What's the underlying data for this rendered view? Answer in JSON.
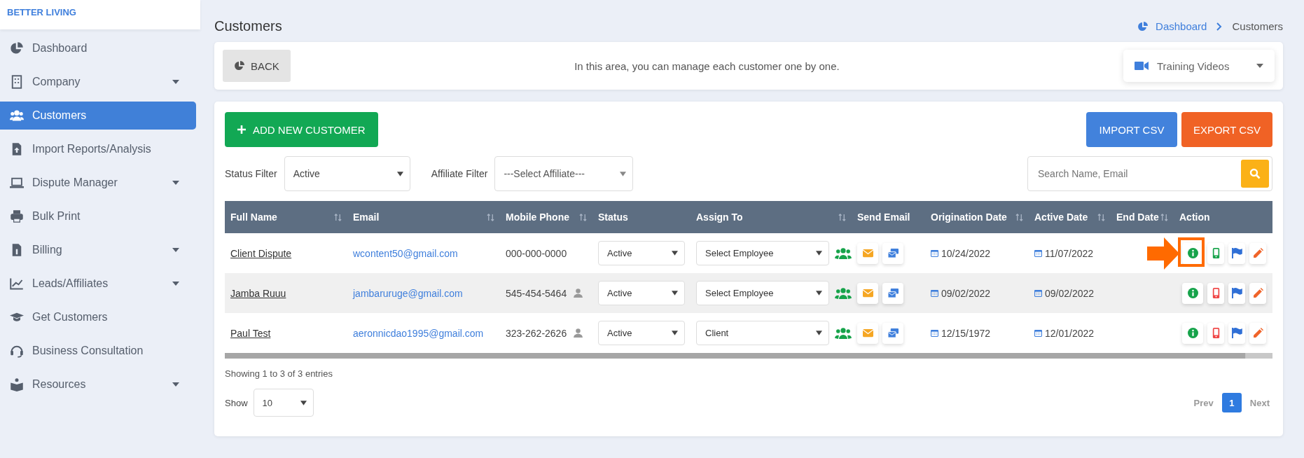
{
  "brand": "BETTER LIVING",
  "sidebar": {
    "items": [
      {
        "label": "Dashboard",
        "kind": "pie",
        "has_dropdown": false,
        "selected": false
      },
      {
        "label": "Company",
        "kind": "building",
        "has_dropdown": true,
        "selected": false
      },
      {
        "label": "Customers",
        "kind": "users",
        "has_dropdown": false,
        "selected": true
      },
      {
        "label": "Import Reports/Analysis",
        "kind": "upload",
        "has_dropdown": false,
        "selected": false
      },
      {
        "label": "Dispute Manager",
        "kind": "laptop",
        "has_dropdown": true,
        "selected": false
      },
      {
        "label": "Bulk Print",
        "kind": "printer",
        "has_dropdown": false,
        "selected": false
      },
      {
        "label": "Billing",
        "kind": "invoice",
        "has_dropdown": true,
        "selected": false
      },
      {
        "label": "Leads/Affiliates",
        "kind": "chart",
        "has_dropdown": true,
        "selected": false
      },
      {
        "label": "Get Customers",
        "kind": "cap",
        "has_dropdown": false,
        "selected": false
      },
      {
        "label": "Business Consultation",
        "kind": "headset",
        "has_dropdown": false,
        "selected": false
      },
      {
        "label": "Resources",
        "kind": "book",
        "has_dropdown": true,
        "selected": false
      }
    ]
  },
  "page_title": "Customers",
  "breadcrumb": [
    "Dashboard",
    "Customers"
  ],
  "intro": {
    "back_button": "BACK",
    "message": "In this area, you can manage each customer one by one.",
    "training_videos": "Training Videos"
  },
  "toolbar": {
    "add_button": "ADD NEW CUSTOMER",
    "import_button": "IMPORT CSV",
    "export_button": "EXPORT CSV"
  },
  "filters": {
    "status_label": "Status Filter",
    "status_value": "Active",
    "affiliate_label": "Affiliate Filter",
    "affiliate_value": "---Select Affiliate---",
    "search_placeholder": "Search Name, Email"
  },
  "table": {
    "columns": [
      {
        "label": "Full Name",
        "sortable": true
      },
      {
        "label": "Email",
        "sortable": true
      },
      {
        "label": "Mobile Phone",
        "sortable": true
      },
      {
        "label": "Status",
        "sortable": false
      },
      {
        "label": "Assign To",
        "sortable": true
      },
      {
        "label": "Send Email",
        "sortable": false
      },
      {
        "label": "Origination Date",
        "sortable": true
      },
      {
        "label": "Active Date",
        "sortable": true
      },
      {
        "label": "End Date",
        "sortable": true
      },
      {
        "label": "Action",
        "sortable": false
      }
    ],
    "rows": [
      {
        "name": "Client Dispute",
        "email": "wcontent50@gmail.com",
        "phone": "000-000-0000",
        "contact_icon": false,
        "status": "Active",
        "assign": "Select Employee",
        "origination": "10/24/2022",
        "active": "11/07/2022",
        "color": "#16a34a",
        "highlighted": true
      },
      {
        "name": "Jamba Ruuu",
        "email": "jambaruruge@gmail.com",
        "phone": "545-454-5464",
        "contact_icon": true,
        "status": "Active",
        "assign": "Select Employee",
        "origination": "09/02/2022",
        "active": "09/02/2022",
        "color": "#ef4444",
        "highlighted": false
      },
      {
        "name": "Paul Test",
        "email": "aeronnicdao1995@gmail.com",
        "phone": "323-262-2626",
        "contact_icon": true,
        "status": "Active",
        "assign": "Client",
        "origination": "12/15/1972",
        "active": "12/01/2022",
        "color": "#ef4444",
        "highlighted": false
      }
    ]
  },
  "footer": {
    "info": "Showing 1 to 3 of 3 entries",
    "show_label": "Show",
    "page_size": "10",
    "pagination": [
      {
        "label": "Prev",
        "kind": "nav",
        "selected": false
      },
      {
        "label": "1",
        "kind": "page",
        "selected": true
      },
      {
        "label": "Next",
        "kind": "nav",
        "selected": false
      }
    ]
  }
}
